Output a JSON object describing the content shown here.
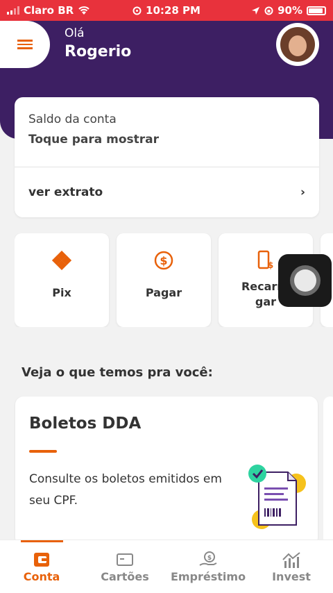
{
  "status_bar": {
    "carrier": "Claro BR",
    "time": "10:28 PM",
    "battery": "90%"
  },
  "header": {
    "greeting": "Olá",
    "username": "Rogerio"
  },
  "balance_card": {
    "label": "Saldo da conta",
    "value": "Toque para mostrar",
    "statement_link": "ver extrato"
  },
  "quick_actions": [
    {
      "label": "Pix",
      "icon": "pix-icon"
    },
    {
      "label": "Pagar",
      "icon": "dollar-circle-icon"
    },
    {
      "label": "Recarregar",
      "icon": "phone-recharge-icon"
    }
  ],
  "section_title": "Veja o que temos pra você:",
  "promo": {
    "title": "Boletos DDA",
    "description": "Consulte os boletos emitidos em seu CPF."
  },
  "tabs": [
    {
      "label": "Conta",
      "icon": "wallet-icon",
      "active": true
    },
    {
      "label": "Cartões",
      "icon": "card-icon",
      "active": false
    },
    {
      "label": "Empréstimo",
      "icon": "loan-icon",
      "active": false
    },
    {
      "label": "Invest",
      "icon": "chart-icon",
      "active": false
    }
  ],
  "colors": {
    "accent": "#e8610a",
    "header_bg": "#3d1f63",
    "status_bar": "#e8323c"
  }
}
